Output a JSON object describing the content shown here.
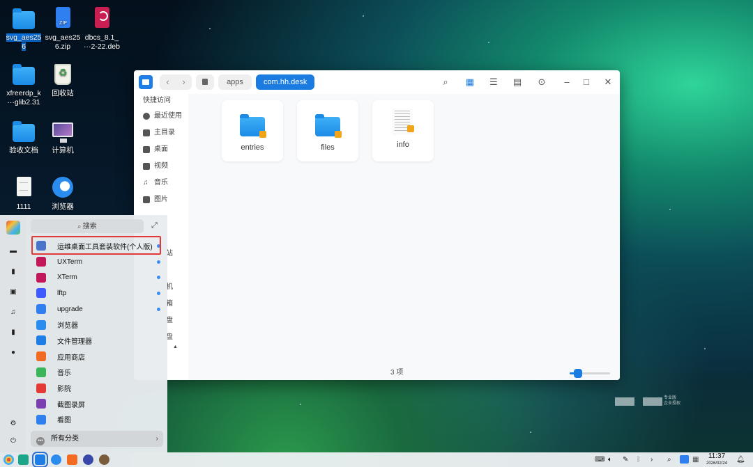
{
  "desktop": {
    "icons": [
      {
        "label_a": "svg_aes25",
        "label_b": "6"
      },
      {
        "label_a": "svg_aes25",
        "label_b": "6.zip",
        "badge": "ZIP"
      },
      {
        "label_a": "dbcs_8.1_",
        "label_b": "···2-22.deb"
      },
      {
        "label_a": "xfreerdp_k",
        "label_b": "···glib2.31"
      },
      {
        "label_a": "回收站"
      },
      {
        "label_a": "验收文档"
      },
      {
        "label_a": "计算机"
      },
      {
        "label_a": "1111"
      },
      {
        "label_a": "浏览器"
      }
    ]
  },
  "file_manager": {
    "breadcrumbs": [
      "apps",
      "com.hh.desk"
    ],
    "nav": {
      "back": "‹",
      "forward": "›"
    },
    "sidebar": {
      "heading": "快捷访问",
      "items": [
        "最近使用",
        "主目录",
        "桌面",
        "视频",
        "音乐",
        "图片"
      ],
      "partial": [
        "站",
        "机",
        "箱",
        "盘",
        "盘",
        "▲"
      ]
    },
    "files": [
      {
        "name": "entries",
        "type": "folder"
      },
      {
        "name": "files",
        "type": "folder"
      },
      {
        "name": "info",
        "type": "file"
      }
    ],
    "status": "3 项",
    "zoom_level": 0.2
  },
  "launcher": {
    "search_placeholder": "搜索",
    "apps": [
      {
        "name": "运维桌面工具套装软件(个人版)",
        "new": true,
        "color": "#4a74c9"
      },
      {
        "name": "UXTerm",
        "new": true,
        "color": "#c2185b"
      },
      {
        "name": "XTerm",
        "new": true,
        "color": "#c2185b"
      },
      {
        "name": "lftp",
        "new": true,
        "color": "#3d5afe"
      },
      {
        "name": "upgrade",
        "new": true,
        "color": "#2f7ff0"
      },
      {
        "name": "浏览器",
        "new": false,
        "color": "#2b8cf0"
      },
      {
        "name": "文件管理器",
        "new": false,
        "color": "#1f7ee6"
      },
      {
        "name": "应用商店",
        "new": false,
        "color": "#f36b21"
      },
      {
        "name": "音乐",
        "new": false,
        "color": "#3bb55a"
      },
      {
        "name": "影院",
        "new": false,
        "color": "#e53935"
      },
      {
        "name": "截图录屏",
        "new": false,
        "color": "#7b3fb0"
      },
      {
        "name": "看图",
        "new": false,
        "color": "#2f7ff0"
      }
    ],
    "all_categories": "所有分类",
    "highlight_color": "#e2383a"
  },
  "taskbar": {
    "time": "11:37",
    "date": "2026/02/24"
  },
  "watermark": {
    "line1": "专业版",
    "line2": "企业授权"
  },
  "colors": {
    "accent": "#1a7be0",
    "new_dot": "#3b8cf3"
  }
}
